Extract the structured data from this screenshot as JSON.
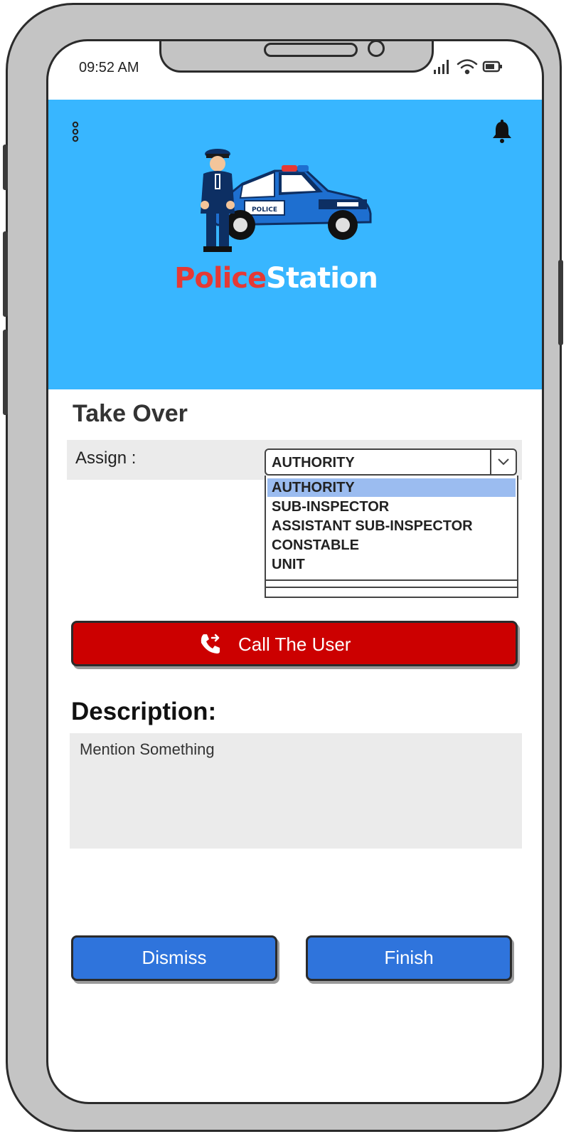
{
  "status_bar": {
    "time": "09:52 AM",
    "icons": [
      "signal-icon",
      "wifi-icon",
      "battery-icon"
    ]
  },
  "header": {
    "background_color": "#38b6ff",
    "brand_part1": "Police",
    "brand_part2": "Station",
    "brand_part1_color": "#e53935",
    "brand_part2_color": "#ffffff",
    "hero_image": "police-officer-with-car",
    "hero_car_label": "POLICE",
    "left_icon": "more-vertical-icon",
    "right_icon": "bell-icon"
  },
  "page": {
    "title": "Take Over"
  },
  "assign": {
    "label": "Assign :",
    "selected": "AUTHORITY",
    "options": [
      "AUTHORITY",
      "SUB-INSPECTOR",
      "ASSISTANT SUB-INSPECTOR",
      "CONSTABLE",
      "UNIT"
    ],
    "highlight_color": "#9bbcf0"
  },
  "call_button": {
    "label": "Call The User",
    "icon": "phone-outgoing-icon",
    "color": "#cc0000"
  },
  "description": {
    "title": "Description:",
    "placeholder": "Mention Something"
  },
  "actions": {
    "dismiss_label": "Dismiss",
    "finish_label": "Finish",
    "color": "#2f74dc"
  }
}
